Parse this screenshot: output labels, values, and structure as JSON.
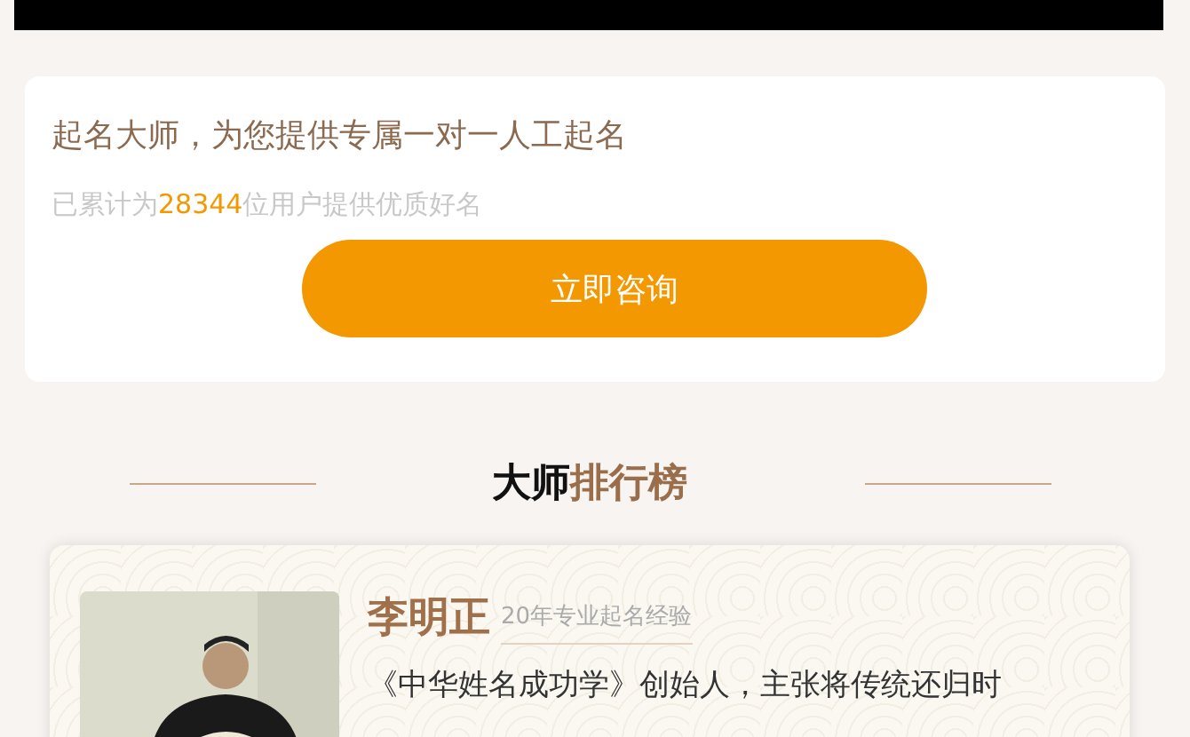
{
  "intro": {
    "title": "起名大师，为您提供专属一对一人工起名",
    "stats": {
      "before": "已累计为",
      "count": "28344",
      "after": "位用户提供优质好名"
    },
    "button": "立即咨询"
  },
  "ranking": {
    "heading": {
      "lead": "大师",
      "rest": "排行榜"
    },
    "masters": [
      {
        "name": "李明正",
        "tag": "20年专业起名经验",
        "bio": "《中华姓名成功学》创始人，主张将传统还归时"
      }
    ]
  }
}
